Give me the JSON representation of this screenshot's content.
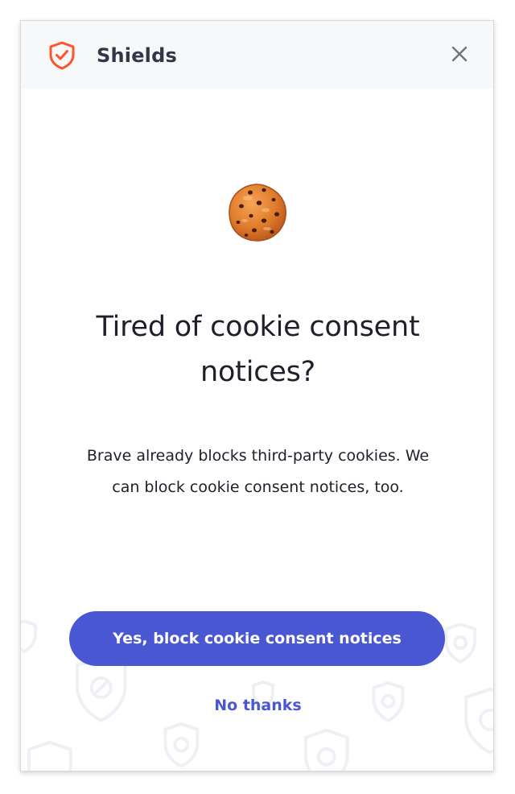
{
  "header": {
    "title": "Shields",
    "logo_icon": "brave-shield-icon",
    "close_icon": "close-icon"
  },
  "main": {
    "illustration_icon": "cookie-icon",
    "headline_line1": "Tired of cookie consent",
    "headline_line2": "notices?",
    "description_line1": "Brave already blocks third-party cookies. We",
    "description_line2": "can block cookie consent notices, too."
  },
  "actions": {
    "primary_label": "Yes, block cookie consent notices",
    "secondary_label": "No thanks"
  },
  "colors": {
    "brand_shield": "#fb542b",
    "accent": "#4a57d3",
    "header_bg": "#f7f8f9",
    "text": "#1e2029"
  }
}
